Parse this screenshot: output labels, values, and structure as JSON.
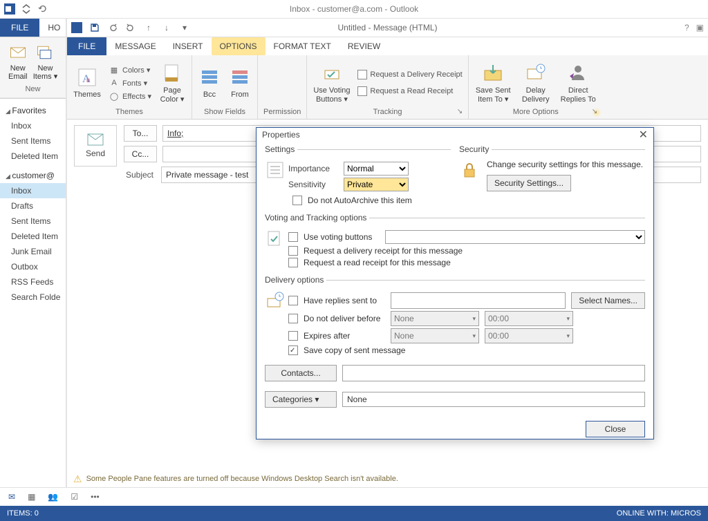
{
  "outer_window": {
    "title": "Inbox - customer@a.com - Outlook",
    "file_tab": "FILE",
    "home_tab_truncated": "HO",
    "new_group": {
      "new_email": "New\nEmail",
      "new_items": "New\nItems ▾",
      "label": "New"
    },
    "favorites_hdr": "Favorites",
    "favorites": [
      "Inbox",
      "Sent Items",
      "Deleted Item"
    ],
    "account_hdr": "customer@",
    "folders": [
      "Inbox",
      "Drafts",
      "Sent Items",
      "Deleted Item",
      "Junk Email",
      "Outbox",
      "RSS Feeds",
      "Search Folde"
    ],
    "selected_folder": "Inbox"
  },
  "compose_window": {
    "title": "Untitled - Message (HTML)",
    "tabs": {
      "file": "FILE",
      "message": "MESSAGE",
      "insert": "INSERT",
      "options": "OPTIONS",
      "format": "FORMAT TEXT",
      "review": "REVIEW"
    },
    "ribbon": {
      "themes": {
        "colors": "Colors ▾",
        "fonts": "Fonts ▾",
        "effects": "Effects ▾",
        "page_color": "Page\nColor ▾",
        "label": "Themes",
        "themes_btn": "Themes"
      },
      "show_fields": {
        "bcc": "Bcc",
        "from": "From",
        "label": "Show Fields"
      },
      "permission": {
        "label": "Permission"
      },
      "tracking": {
        "use_voting": "Use Voting\nButtons ▾",
        "req_delivery": "Request a Delivery Receipt",
        "req_read": "Request a Read Receipt",
        "label": "Tracking"
      },
      "more": {
        "save_sent": "Save Sent\nItem To ▾",
        "delay": "Delay\nDelivery",
        "direct": "Direct\nReplies To",
        "label": "More Options"
      }
    },
    "header": {
      "send": "Send",
      "to_btn": "To...",
      "cc_btn": "Cc...",
      "subject_lbl": "Subject",
      "to_value": "Info;",
      "cc_value": "",
      "subject_value": "Private message - test"
    }
  },
  "properties_dialog": {
    "title": "Properties",
    "settings_legend": "Settings",
    "security_legend": "Security",
    "importance_lbl": "Importance",
    "importance_val": "Normal",
    "sensitivity_lbl": "Sensitivity",
    "sensitivity_val": "Private",
    "do_not_autoarchive": "Do not AutoArchive this item",
    "security_text": "Change security settings for this message.",
    "security_btn": "Security Settings...",
    "voting_legend": "Voting and Tracking options",
    "use_voting": "Use voting buttons",
    "req_delivery": "Request a delivery receipt for this message",
    "req_read": "Request a read receipt for this message",
    "delivery_legend": "Delivery options",
    "have_replies": "Have replies sent to",
    "select_names": "Select Names...",
    "do_not_deliver_before": "Do not deliver before",
    "expires_after": "Expires after",
    "none": "None",
    "time_zero": "00:00",
    "save_copy": "Save copy of sent message",
    "contacts_btn": "Contacts...",
    "categories_btn": "Categories   ▾",
    "categories_val": "None",
    "close_btn": "Close"
  },
  "info_bar": "Some People Pane features are turned off because Windows Desktop Search isn't available.",
  "status": {
    "left": "ITEMS: 0",
    "right": "ONLINE WITH: MICROS"
  }
}
